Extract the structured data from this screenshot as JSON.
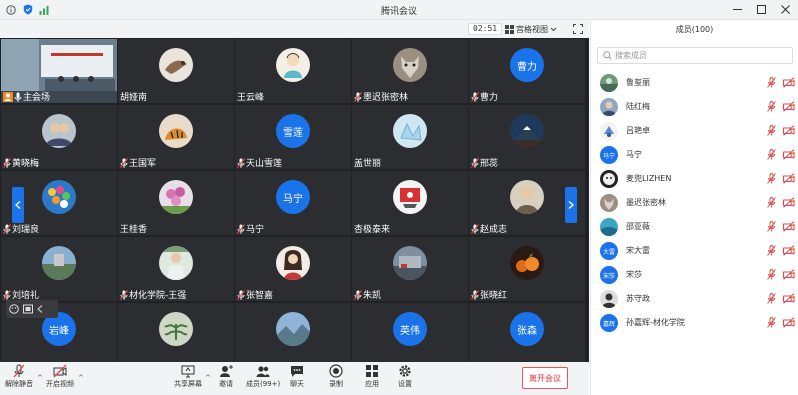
{
  "app": {
    "title": "腾讯会议"
  },
  "meeting": {
    "timer": "02:51",
    "view_label": "宫格视图"
  },
  "grid": {
    "tiles": [
      {
        "name": "主会场",
        "avatar_text": ""
      },
      {
        "name": "胡娅南",
        "avatar_text": ""
      },
      {
        "name": "王云峰",
        "avatar_text": ""
      },
      {
        "name": "墨迟张密林",
        "avatar_text": ""
      },
      {
        "name": "曹力",
        "avatar_text": "曹力"
      },
      {
        "name": "黄晓梅",
        "avatar_text": ""
      },
      {
        "name": "王国军",
        "avatar_text": ""
      },
      {
        "name": "天山雪莲",
        "avatar_text": "雪莲"
      },
      {
        "name": "盖世丽",
        "avatar_text": ""
      },
      {
        "name": "邢蕊",
        "avatar_text": ""
      },
      {
        "name": "刘瑞良",
        "avatar_text": ""
      },
      {
        "name": "王桂香",
        "avatar_text": ""
      },
      {
        "name": "马宁",
        "avatar_text": "马宁"
      },
      {
        "name": "杏极泰来",
        "avatar_text": ""
      },
      {
        "name": "赵成志",
        "avatar_text": ""
      },
      {
        "name": "刘培礼",
        "avatar_text": ""
      },
      {
        "name": "材化学院-王强",
        "avatar_text": ""
      },
      {
        "name": "张智嘉",
        "avatar_text": ""
      },
      {
        "name": "朱凯",
        "avatar_text": ""
      },
      {
        "name": "张晓红",
        "avatar_text": ""
      },
      {
        "name": "",
        "avatar_text": "岩峰"
      },
      {
        "name": "",
        "avatar_text": ""
      },
      {
        "name": "",
        "avatar_text": ""
      },
      {
        "name": "",
        "avatar_text": "英伟"
      },
      {
        "name": "",
        "avatar_text": "张森"
      }
    ]
  },
  "toolbar": {
    "unmute_label": "解除静音",
    "video_label": "开启视频",
    "share_label": "共享屏幕",
    "invite_label": "邀请",
    "members_label": "成员(99+)",
    "chat_label": "聊天",
    "record_label": "录制",
    "apps_label": "应用",
    "settings_label": "设置",
    "leave_label": "离开会议"
  },
  "panel": {
    "title": "成员(100)",
    "search_placeholder": "搜索成员",
    "members": [
      {
        "name": "鲁玺丽",
        "avatar_text": ""
      },
      {
        "name": "陆红梅",
        "avatar_text": ""
      },
      {
        "name": "吕艳卓",
        "avatar_text": ""
      },
      {
        "name": "马宁",
        "avatar_text": "马宁"
      },
      {
        "name": "麦兜LIZHEN",
        "avatar_text": ""
      },
      {
        "name": "墨迟张密林",
        "avatar_text": ""
      },
      {
        "name": "邵亚薇",
        "avatar_text": ""
      },
      {
        "name": "宋大雷",
        "avatar_text": "大雷"
      },
      {
        "name": "宋莎",
        "avatar_text": "宋莎"
      },
      {
        "name": "苏守政",
        "avatar_text": ""
      },
      {
        "name": "孙嘉辉-材化学院",
        "avatar_text": "嘉辉"
      }
    ]
  },
  "colors": {
    "accent": "#1a73e8",
    "leave": "#e33333",
    "muted": "#e04848",
    "grid_bg": "#202124"
  }
}
